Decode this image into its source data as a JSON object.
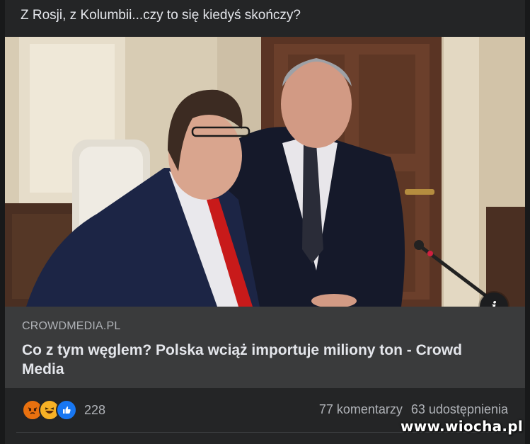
{
  "post": {
    "text": "Z Rosji, z Kolumbii...czy to się kiedyś skończy?",
    "link": {
      "domain": "CROWDMEDIA.PL",
      "headline": "Co z tym węglem? Polska wciąż importuje miliony ton - Crowd Media"
    },
    "photo_icon": "info-icon",
    "reactions": {
      "icons": [
        "angry-icon",
        "haha-icon",
        "like-icon"
      ],
      "count": "228"
    },
    "comments": "77 komentarzy",
    "shares": "63 udostępnienia"
  },
  "watermark": "www.wiocha.pl",
  "colors": {
    "background": "#18191a",
    "card": "#242526",
    "link_box": "#3a3b3c",
    "text_primary": "#e4e6eb",
    "text_secondary": "#b0b3b8",
    "like_blue": "#1877f2",
    "angry_orange": "#e9710f",
    "haha_yellow": "#f7b125"
  }
}
